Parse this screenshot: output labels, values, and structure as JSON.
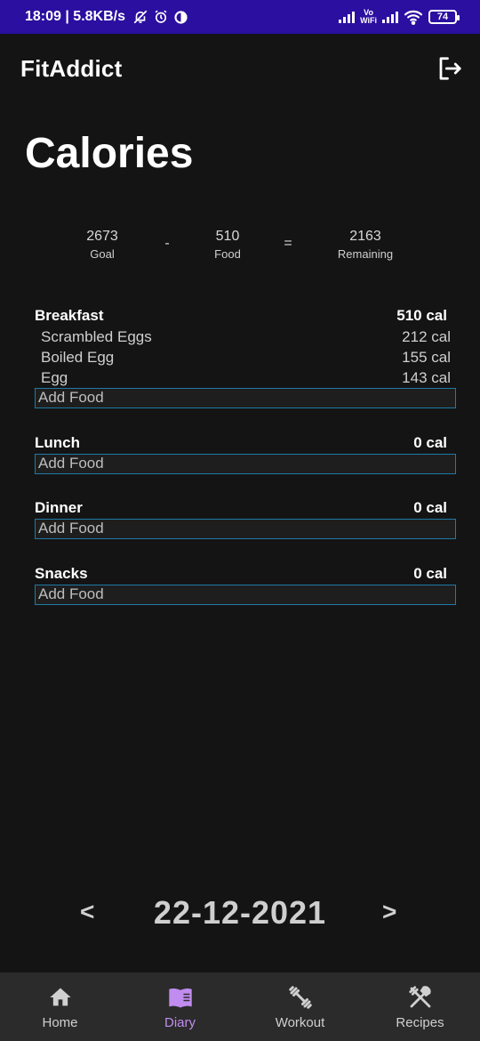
{
  "status_bar": {
    "time_speed": "18:09 | 5.8KB/s",
    "vo": "Vo",
    "wifi_label": "WiFi",
    "battery": "74"
  },
  "app": {
    "title": "FitAddict"
  },
  "page": {
    "title": "Calories"
  },
  "summary": {
    "goal_value": "2673",
    "goal_label": "Goal",
    "minus": "-",
    "food_value": "510",
    "food_label": "Food",
    "equals": "=",
    "remaining_value": "2163",
    "remaining_label": "Remaining"
  },
  "meals": [
    {
      "name": "Breakfast",
      "calories": "510 cal",
      "items": [
        {
          "name": "Scrambled Eggs",
          "calories": "212 cal"
        },
        {
          "name": "Boiled Egg",
          "calories": "155 cal"
        },
        {
          "name": "Egg",
          "calories": "143 cal"
        }
      ],
      "add_label": "Add Food"
    },
    {
      "name": "Lunch",
      "calories": "0 cal",
      "items": [],
      "add_label": "Add Food"
    },
    {
      "name": "Dinner",
      "calories": "0 cal",
      "items": [],
      "add_label": "Add Food"
    },
    {
      "name": "Snacks",
      "calories": "0 cal",
      "items": [],
      "add_label": "Add Food"
    }
  ],
  "date_nav": {
    "prev": "<",
    "date": "22-12-2021",
    "next": ">"
  },
  "bottom_nav": {
    "items": [
      {
        "label": "Home",
        "icon": "home-icon"
      },
      {
        "label": "Diary",
        "icon": "book-icon",
        "active": true
      },
      {
        "label": "Workout",
        "icon": "dumbbell-icon"
      },
      {
        "label": "Recipes",
        "icon": "utensils-icon"
      }
    ]
  },
  "colors": {
    "status_bar": "#2a0fa0",
    "background": "#141414",
    "accent_active": "#c18cf0",
    "input_border": "#1f7aa6",
    "bottom_nav": "#2b2b2b"
  }
}
